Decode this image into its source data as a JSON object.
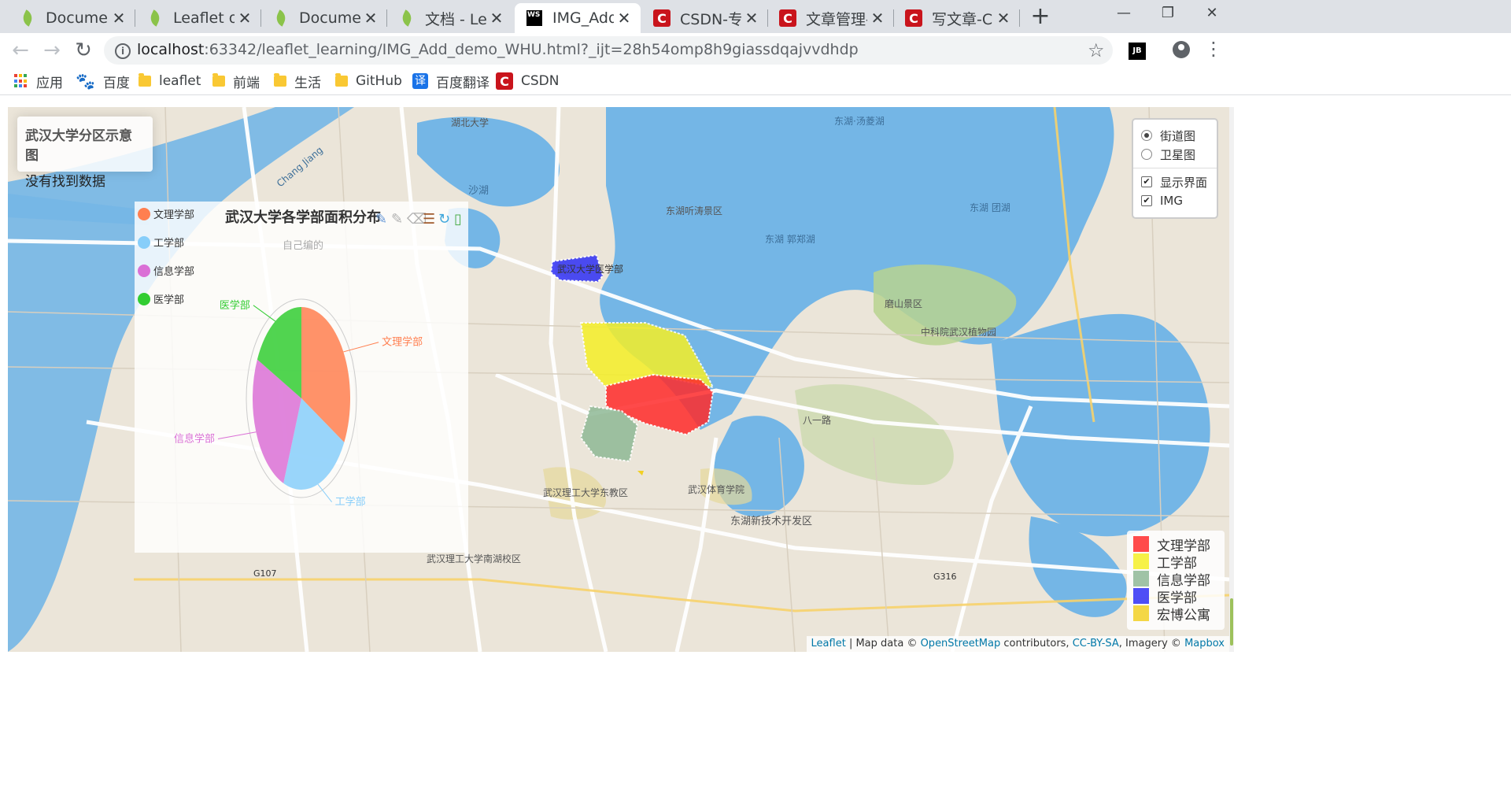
{
  "browser": {
    "tabs": [
      {
        "title": "Documenta",
        "icon": "leaflet-icon"
      },
      {
        "title": "Leaflet on M",
        "icon": "leaflet-icon"
      },
      {
        "title": "Documenta",
        "icon": "leaflet-icon"
      },
      {
        "title": "文档 - Leafl",
        "icon": "leaflet-icon"
      },
      {
        "title": "IMG_Add_d",
        "icon": "webstorm-icon",
        "active": true
      },
      {
        "title": "CSDN-专业I",
        "icon": "csdn-icon"
      },
      {
        "title": "文章管理-CS",
        "icon": "csdn-icon"
      },
      {
        "title": "写文章-CSD",
        "icon": "csdn-icon"
      }
    ],
    "url_host": "localhost",
    "url_rest": ":63342/leaflet_learning/IMG_Add_demo_WHU.html?_ijt=28h54omp8h9giassdqajvvdhdp",
    "bookmarks": [
      {
        "label": "应用",
        "icon": "apps-icon"
      },
      {
        "label": "百度",
        "icon": "baidu-icon"
      },
      {
        "label": "leaflet",
        "icon": "folder-icon"
      },
      {
        "label": "前端",
        "icon": "folder-icon"
      },
      {
        "label": "生活",
        "icon": "folder-icon"
      },
      {
        "label": "GitHub",
        "icon": "folder-icon"
      },
      {
        "label": "百度翻译",
        "icon": "translate-icon"
      },
      {
        "label": "CSDN",
        "icon": "csdn-icon"
      }
    ]
  },
  "info": {
    "title": "武汉大学分区示意图",
    "message": "没有找到数据"
  },
  "layers": {
    "base": [
      {
        "label": "街道图",
        "selected": true
      },
      {
        "label": "卫星图",
        "selected": false
      }
    ],
    "overlays": [
      {
        "label": "显示界面",
        "checked": true
      },
      {
        "label": "IMG",
        "checked": true
      }
    ]
  },
  "chart": {
    "title": "武汉大学各学部面积分布",
    "subtitle": "自己编的",
    "legend": [
      "文理学部",
      "工学部",
      "信息学部",
      "医学部"
    ],
    "toolbox_icons": [
      "mark-icon",
      "undo-mark-icon",
      "clear-mark-icon",
      "data-view-icon",
      "restore-icon",
      "save-image-icon"
    ]
  },
  "chart_data": {
    "type": "pie",
    "title": "武汉大学各学部面积分布",
    "subtitle": "自己编的",
    "categories": [
      "文理学部",
      "工学部",
      "信息学部",
      "医学部"
    ],
    "values": [
      33,
      23,
      26,
      18
    ],
    "colors": [
      "#ff7f50",
      "#87cefa",
      "#da70d6",
      "#32cd32"
    ],
    "legend_position": "left"
  },
  "map_legend": [
    {
      "label": "文理学部",
      "color": "#ff2b2b"
    },
    {
      "label": "工学部",
      "color": "#f5ef27"
    },
    {
      "label": "信息学部",
      "color": "#8fb996"
    },
    {
      "label": "医学部",
      "color": "#2f2ff5"
    },
    {
      "label": "宏博公寓",
      "color": "#f2d024"
    }
  ],
  "map_labels": {
    "poi_med": "武汉大学医学部",
    "hubei_univ": "湖北大学",
    "shahu": "沙湖",
    "donghu_tang": "东湖·汤菱湖",
    "donghu_tingtao": "东湖听涛景区",
    "donghu_tuan": "东湖 团湖",
    "donghu_guo": "东湖 郭郑湖",
    "moshan": "磨山景区",
    "zhongke": "中科院武汉植物园",
    "wut_east": "武汉理工大学东教区",
    "wut_south": "武汉理工大学南湖校区",
    "tiyu": "武汉体育学院",
    "donghu_dev": "东湖新技术开发区",
    "changjiang": "Chang Jiang",
    "g107": "G107",
    "g316": "G316",
    "bayi": "八一路"
  },
  "attribution": {
    "leaflet": "Leaflet",
    "text1": " | Map data © ",
    "osm": "OpenStreetMap",
    "text2": " contributors, ",
    "ccbysa": "CC-BY-SA",
    "text3": ", Imagery © ",
    "mapbox": "Mapbox"
  }
}
